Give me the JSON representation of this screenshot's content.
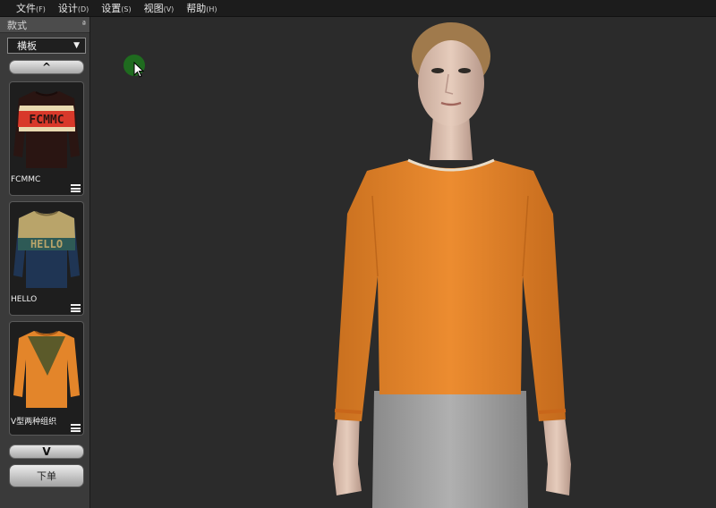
{
  "menu": {
    "file": "文件",
    "file_key": "(F)",
    "design": "设计",
    "design_key": "(D)",
    "settings": "设置",
    "settings_key": "(S)",
    "view": "视图",
    "view_key": "(V)",
    "help": "帮助",
    "help_key": "(H)"
  },
  "panel": {
    "title": "款式",
    "pin_glyph": "ª",
    "select_value": "横板",
    "select_arrow": "▼",
    "scroll_up": "^",
    "scroll_down": "V",
    "order_button": "下单",
    "items": [
      {
        "label": "FCMMC",
        "print_text": "FCMMC"
      },
      {
        "label": "HELLO",
        "print_text": "HELLO"
      },
      {
        "label": "V型两种组织"
      }
    ]
  },
  "colors": {
    "sweater_orange": "#e3852a",
    "pants_gray": "#9a9a9a",
    "viewport_bg": "#2b2b2b",
    "cursor_green": "#1f6b1f"
  }
}
